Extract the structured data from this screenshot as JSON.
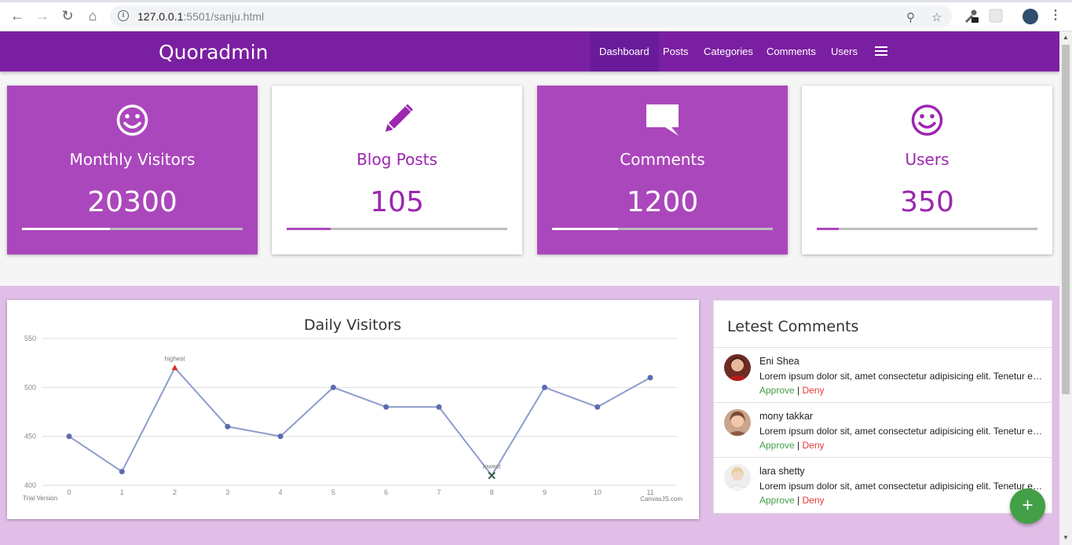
{
  "browser": {
    "url_host": "127.0.0.1",
    "url_rest": ":5501/sanju.html"
  },
  "app": {
    "brand": "Quoradmin",
    "nav": [
      {
        "label": "Dashboard",
        "active": true
      },
      {
        "label": "Posts"
      },
      {
        "label": "Categories"
      },
      {
        "label": "Comments"
      },
      {
        "label": "Users"
      }
    ]
  },
  "stats": [
    {
      "label": "Monthly Visitors",
      "value": "20300",
      "icon": "smiley-icon",
      "style": "filled",
      "progress": 0.4
    },
    {
      "label": "Blog Posts",
      "value": "105",
      "icon": "pencil-icon",
      "style": "white",
      "progress": 0.2
    },
    {
      "label": "Comments",
      "value": "1200",
      "icon": "comment-icon",
      "style": "filled",
      "progress": 0.3
    },
    {
      "label": "Users",
      "value": "350",
      "icon": "smiley-icon",
      "style": "white",
      "progress": 0.1
    }
  ],
  "chart_data": {
    "type": "line",
    "title": "Daily Visitors",
    "x": [
      0,
      1,
      2,
      3,
      4,
      5,
      6,
      7,
      8,
      9,
      10,
      11
    ],
    "values": [
      450,
      414,
      520,
      460,
      450,
      500,
      480,
      480,
      410,
      500,
      480,
      510
    ],
    "ylim": [
      400,
      550
    ],
    "yticks": [
      400,
      450,
      500,
      550
    ],
    "annotations": [
      {
        "x": 2,
        "label": "highest",
        "marker": "triangle",
        "color": "#d32f2f"
      },
      {
        "x": 8,
        "label": "lowest",
        "marker": "cross",
        "color": "#2e5d4f"
      }
    ],
    "line_color": "#8e9ccc",
    "grid": true,
    "footer_left": "Trial Version",
    "footer_right": "CanvasJS.com"
  },
  "comments": {
    "title": "Letest Comments",
    "items": [
      {
        "name": "Eni Shea",
        "text": "Lorem ipsum dolor sit, amet consectetur adipisicing elit. Tenetur eum ullam quidem",
        "approve": "Approve",
        "sep": "|",
        "deny": "Deny"
      },
      {
        "name": "mony takkar",
        "text": "Lorem ipsum dolor sit, amet consectetur adipisicing elit. Tenetur eum ullam quidem",
        "approve": "Approve",
        "sep": "|",
        "deny": "Deny"
      },
      {
        "name": "lara shetty",
        "text": "Lorem ipsum dolor sit, amet consectetur adipisicing elit. Tenetur eum ullam quidem",
        "approve": "Approve",
        "sep": "|",
        "deny": "Deny"
      }
    ]
  },
  "fab": {
    "label": "+",
    "color": "#43a047"
  }
}
